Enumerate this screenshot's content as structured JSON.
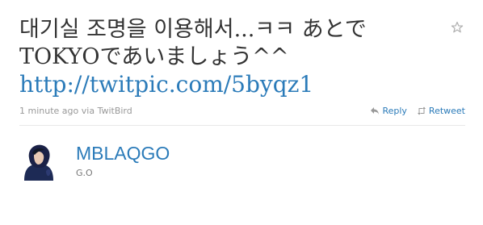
{
  "tweet": {
    "line1": "대기실 조명을 이용해서...ㅋㅋ あとで",
    "line2": "TOKYOであいましょう^^",
    "link": "http://twitpic.com/5byqz1"
  },
  "meta": {
    "time": "1 minute ago",
    "via_prefix": "via",
    "client": "TwitBird"
  },
  "actions": {
    "reply_label": "Reply",
    "retweet_label": "Retweet"
  },
  "user": {
    "screen_name": "MBLAQGO",
    "full_name": "G.O"
  },
  "colors": {
    "link": "#2b7bb9",
    "text": "#333333",
    "meta": "#999999"
  },
  "icons": {
    "favorite": "star-icon",
    "reply": "reply-icon",
    "retweet": "retweet-icon"
  }
}
